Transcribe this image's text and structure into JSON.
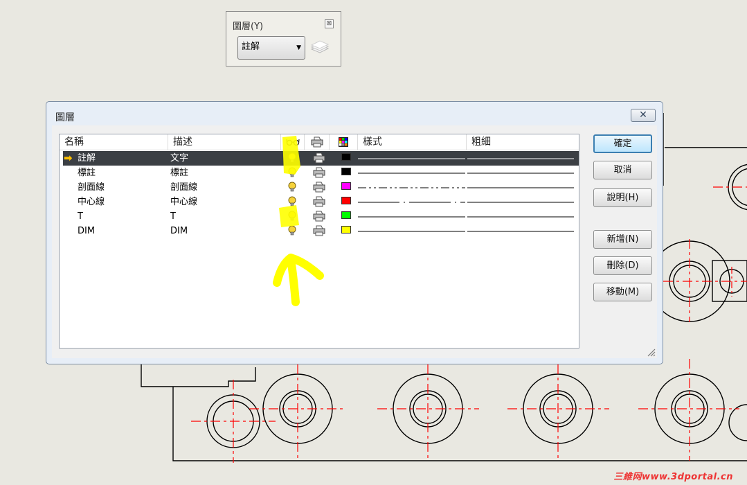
{
  "layer_toolbar": {
    "title": "圖層(Y)",
    "close_glyph": "⊠",
    "current_layer": "註解",
    "icons": [
      "chevron-down-icon",
      "layer-stack-icon"
    ]
  },
  "dialog": {
    "title": "圖層",
    "close_glyph": "✕",
    "columns": {
      "name": "名稱",
      "description": "描述",
      "visible_icon": "glasses-icon",
      "print_icon": "printer-icon",
      "color_icon": "color-palette-icon",
      "style": "樣式",
      "thickness": "粗細"
    },
    "rows": [
      {
        "name": "註解",
        "description": "文字",
        "color": "#000000",
        "line_style": "solid",
        "selected": true,
        "current": true
      },
      {
        "name": "標註",
        "description": "標註",
        "color": "#000000",
        "line_style": "solid",
        "selected": false,
        "current": false
      },
      {
        "name": "剖面線",
        "description": "剖面線",
        "color": "#ff00ff",
        "line_style": "phantom",
        "selected": false,
        "current": false
      },
      {
        "name": "中心線",
        "description": "中心線",
        "color": "#ff0000",
        "line_style": "center",
        "selected": false,
        "current": false
      },
      {
        "name": "T",
        "description": "T",
        "color": "#00ff00",
        "line_style": "solid",
        "selected": false,
        "current": false
      },
      {
        "name": "DIM",
        "description": "DIM",
        "color": "#ffff00",
        "line_style": "solid",
        "selected": false,
        "current": false
      }
    ],
    "buttons": {
      "ok": "確定",
      "cancel": "取消",
      "help": "說明(H)",
      "new": "新增(N)",
      "delete": "刪除(D)",
      "move": "移動(M)"
    },
    "accent_color": "#3c7fb1"
  },
  "annotation": {
    "color": "#ffff00",
    "shape": "highlight-and-arrow"
  },
  "watermark": "三維网www.3dportal.cn",
  "colors": {
    "background": "#e9e8e1",
    "drawing_red": "#ff0000",
    "selection": "#3b3f44"
  }
}
